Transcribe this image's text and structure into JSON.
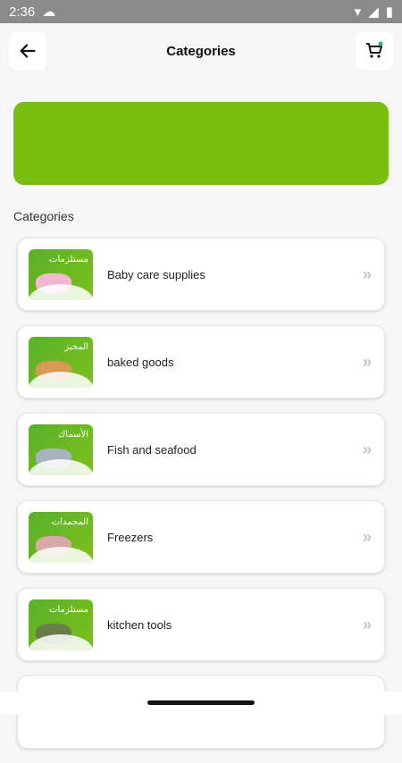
{
  "status": {
    "time": "2:36"
  },
  "header": {
    "title": "Categories"
  },
  "banner": {
    "color": "#79be0e"
  },
  "section_label": "Categories",
  "categories": [
    {
      "label": "Baby care supplies",
      "thumb_text": "مستلزمات"
    },
    {
      "label": "baked goods",
      "thumb_text": "المخبز"
    },
    {
      "label": "Fish and seafood",
      "thumb_text": "الأسماك"
    },
    {
      "label": "Freezers",
      "thumb_text": "المجمدات"
    },
    {
      "label": "kitchen tools",
      "thumb_text": "مستلزمات"
    }
  ]
}
